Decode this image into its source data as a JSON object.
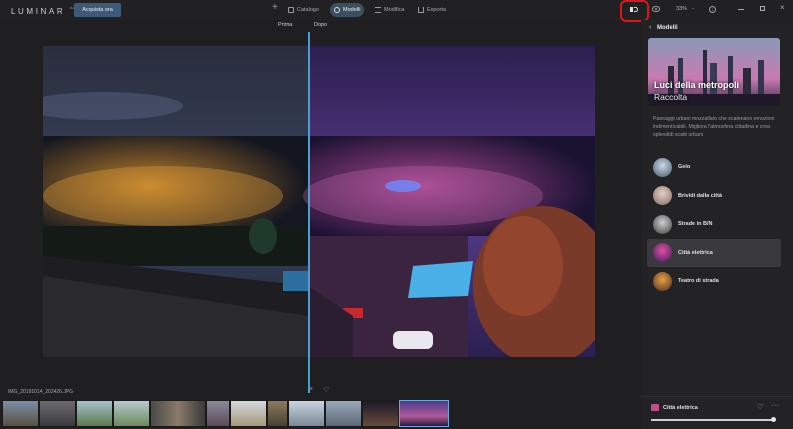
{
  "app": {
    "logo_text": "LUMINAR",
    "logo_version": "AI"
  },
  "topbar": {
    "buy_label": "Acquista ora",
    "add_glyph": "+",
    "tabs": [
      {
        "label": "Catalogo",
        "icon": "grid-icon",
        "active": false
      },
      {
        "label": "Modelli",
        "icon": "people-icon",
        "active": true
      },
      {
        "label": "Modifica",
        "icon": "sliders-icon",
        "active": false
      },
      {
        "label": "Esporta",
        "icon": "upload-icon",
        "active": false
      }
    ],
    "zoom": "33%",
    "compare_icon": "before-after-compare-icon",
    "highlight_color": "#e0141d"
  },
  "canvas": {
    "before_label": "Prima",
    "after_label": "Dopo"
  },
  "filmstrip": {
    "filename": "IMG_20191014_202426.JPG",
    "thumb_count": 11,
    "selected_index": 10
  },
  "panel": {
    "back_glyph": "‹",
    "title": "Modelli",
    "hero": {
      "title": "Luci della metropoli",
      "subtitle": "Raccolta"
    },
    "description": "Paesaggi urbani mozzafiato che scatenano emozioni indimenticabili. Migliora l'atmosfera cittadina e crea splendidi scatti urbani",
    "looks": [
      {
        "name": "Gelo",
        "active": false
      },
      {
        "name": "Brividi dalla città",
        "active": false
      },
      {
        "name": "Strade in B/N",
        "active": false
      },
      {
        "name": "Città elettrica",
        "active": true
      },
      {
        "name": "Teatro di strada",
        "active": false
      }
    ],
    "applied": {
      "name": "Città elettrica",
      "amount": 0.98
    }
  },
  "colors": {
    "accent": "#4a9fd0",
    "active_tab": "#3b4f5e",
    "buy_button": "#3d5a78"
  }
}
